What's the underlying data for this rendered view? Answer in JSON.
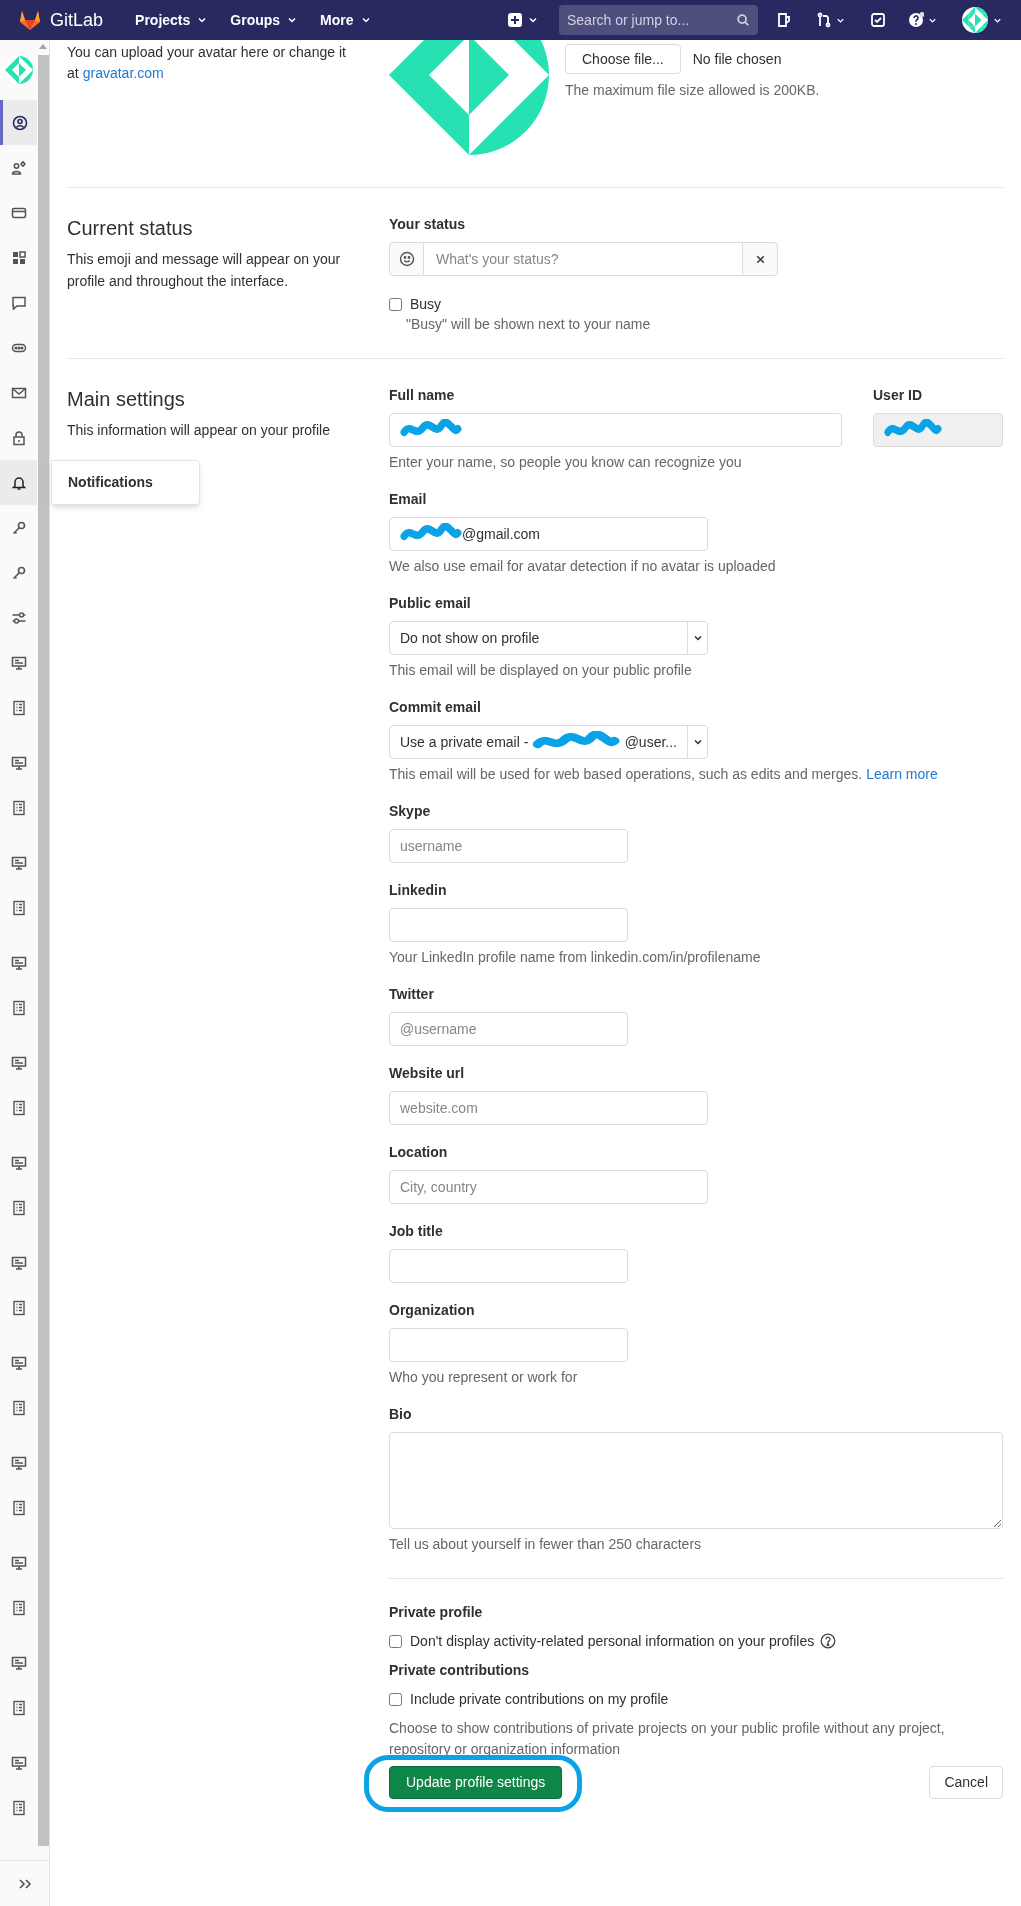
{
  "nav": {
    "brand": "GitLab",
    "menus": [
      {
        "label": "Projects"
      },
      {
        "label": "Groups"
      },
      {
        "label": "More"
      }
    ],
    "search": {
      "placeholder": "Search or jump to..."
    }
  },
  "sidebar": {
    "items": [
      {
        "kind": "profile",
        "selected": true,
        "hovered": false
      },
      {
        "kind": "account",
        "selected": false,
        "hovered": false
      },
      {
        "kind": "billing",
        "selected": false,
        "hovered": false
      },
      {
        "kind": "applications",
        "selected": false,
        "hovered": false
      },
      {
        "kind": "chat",
        "selected": false,
        "hovered": false
      },
      {
        "kind": "comments",
        "selected": false,
        "hovered": false
      },
      {
        "kind": "mail",
        "selected": false,
        "hovered": false
      },
      {
        "kind": "lock",
        "selected": false,
        "hovered": false
      },
      {
        "kind": "bell",
        "selected": false,
        "hovered": true
      },
      {
        "kind": "key",
        "selected": false,
        "hovered": false
      },
      {
        "kind": "key",
        "selected": false,
        "hovered": false
      },
      {
        "kind": "preferences",
        "selected": false,
        "hovered": false
      },
      {
        "kind": "monitor",
        "selected": false,
        "hovered": false
      },
      {
        "kind": "list",
        "selected": false,
        "hovered": false
      },
      {
        "kind": "monitor",
        "selected": false,
        "hovered": false
      },
      {
        "kind": "list",
        "selected": false,
        "hovered": false
      },
      {
        "kind": "monitor",
        "selected": false,
        "hovered": false
      },
      {
        "kind": "list",
        "selected": false,
        "hovered": false
      },
      {
        "kind": "monitor",
        "selected": false,
        "hovered": false
      },
      {
        "kind": "list",
        "selected": false,
        "hovered": false
      },
      {
        "kind": "monitor",
        "selected": false,
        "hovered": false
      },
      {
        "kind": "list",
        "selected": false,
        "hovered": false
      },
      {
        "kind": "monitor",
        "selected": false,
        "hovered": false
      },
      {
        "kind": "list",
        "selected": false,
        "hovered": false
      },
      {
        "kind": "monitor",
        "selected": false,
        "hovered": false
      },
      {
        "kind": "list",
        "selected": false,
        "hovered": false
      },
      {
        "kind": "monitor",
        "selected": false,
        "hovered": false
      },
      {
        "kind": "list",
        "selected": false,
        "hovered": false
      },
      {
        "kind": "monitor",
        "selected": false,
        "hovered": false
      },
      {
        "kind": "list",
        "selected": false,
        "hovered": false
      },
      {
        "kind": "monitor",
        "selected": false,
        "hovered": false
      },
      {
        "kind": "list",
        "selected": false,
        "hovered": false
      },
      {
        "kind": "monitor",
        "selected": false,
        "hovered": false
      },
      {
        "kind": "list",
        "selected": false,
        "hovered": false
      },
      {
        "kind": "monitor",
        "selected": false,
        "hovered": false
      },
      {
        "kind": "list",
        "selected": false,
        "hovered": false
      }
    ],
    "flyout": {
      "label": "Notifications"
    }
  },
  "avatar_section": {
    "text": "You can upload your avatar here or change it at",
    "link": "gravatar.com",
    "file_button": "Choose file...",
    "file_status": "No file chosen",
    "file_hint": "The maximum file size allowed is 200KB."
  },
  "current_status": {
    "title": "Current status",
    "description": "This emoji and message will appear on your profile and throughout the interface.",
    "field": {
      "label": "Your status",
      "placeholder": "What's your status?"
    },
    "busy": {
      "label": "Busy",
      "checked": false,
      "hint": "\"Busy\" will be shown next to your name"
    }
  },
  "main_settings": {
    "title": "Main settings",
    "description": "This information will appear on your profile",
    "fields": [
      {
        "kind": "text",
        "label": "Full name",
        "redacted": true,
        "hint": "Enter your name, so people you know can recognize you",
        "side": {
          "label": "User ID",
          "redacted": true
        }
      },
      {
        "kind": "text",
        "label": "Email",
        "redacted": true,
        "value_after": "@gmail.com",
        "hint": "We also use email for avatar detection if no avatar is uploaded"
      },
      {
        "kind": "select",
        "label": "Public email",
        "value": "Do not show on profile",
        "redacted": false,
        "hint": "This email will be displayed on your public profile"
      },
      {
        "kind": "select",
        "label": "Commit email",
        "value": "Use a private email -",
        "redacted": true,
        "value_after": "@user...",
        "hint": "This email will be used for web based operations, such as edits and merges.",
        "hint_link": "Learn more"
      },
      {
        "kind": "text",
        "label": "Skype",
        "placeholder": "username"
      },
      {
        "kind": "text",
        "label": "Linkedin",
        "hint": "Your LinkedIn profile name from linkedin.com/in/profilename"
      },
      {
        "kind": "text",
        "label": "Twitter",
        "placeholder": "@username"
      },
      {
        "kind": "text",
        "label": "Website url",
        "placeholder": "website.com"
      },
      {
        "kind": "text",
        "label": "Location",
        "placeholder": "City, country"
      },
      {
        "kind": "text",
        "label": "Job title"
      },
      {
        "kind": "text",
        "label": "Organization",
        "hint": "Who you represent or work for"
      },
      {
        "kind": "textarea",
        "label": "Bio",
        "hint": "Tell us about yourself in fewer than 250 characters"
      }
    ]
  },
  "privacy": {
    "private_profile": {
      "title": "Private profile",
      "label": "Don't display activity-related personal information on your profiles",
      "checked": false
    },
    "private_contributions": {
      "title": "Private contributions",
      "label": "Include private contributions on my profile",
      "checked": false,
      "description": "Choose to show contributions of private projects on your public profile without any project, repository or organization information"
    }
  },
  "actions": {
    "submit": {
      "label": "Update profile settings",
      "highlighted": true
    },
    "cancel": {
      "label": "Cancel"
    }
  }
}
